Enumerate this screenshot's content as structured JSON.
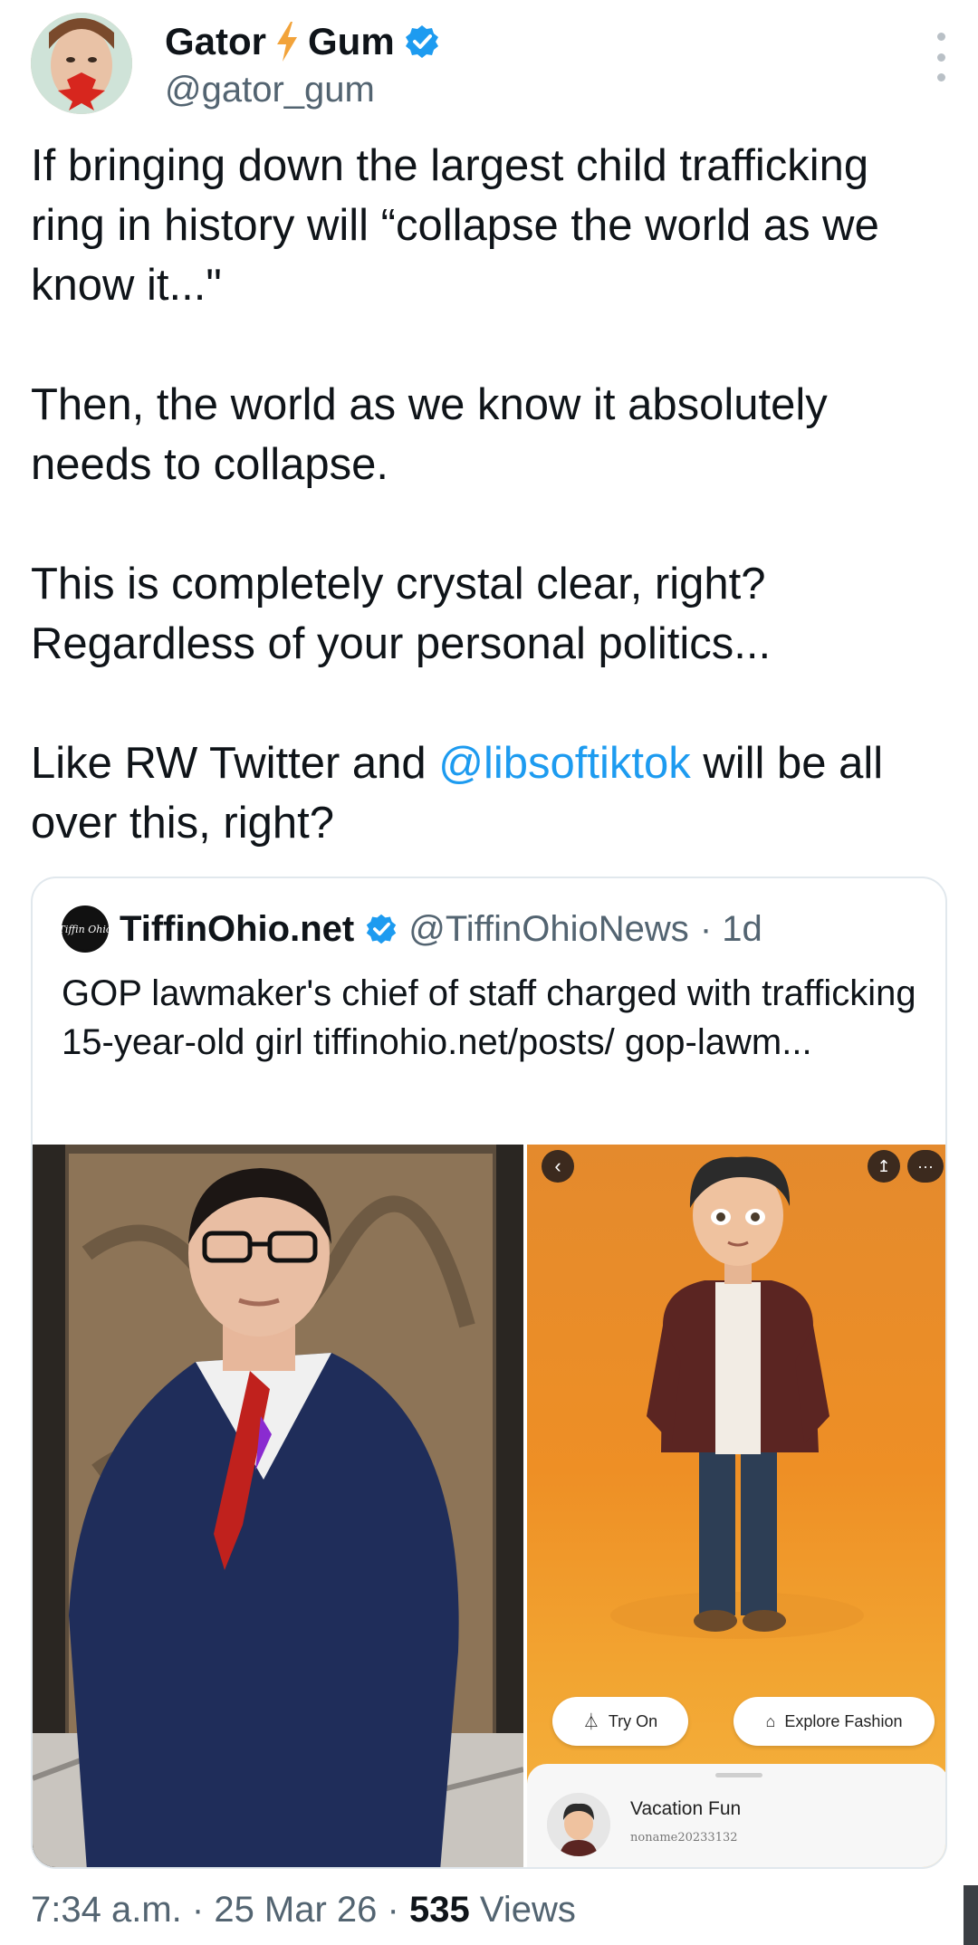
{
  "author": {
    "display_name_part1": "Gator",
    "display_name_part2": "Gum",
    "handle": "@gator_gum"
  },
  "tweet": {
    "paragraph1": "If bringing down the largest child trafficking ring in history will “collapse the world as we know it...\"",
    "paragraph2": " Then, the world as we know it absolutely needs to collapse.",
    "paragraph3": "This is completely crystal clear, right? Regardless of your personal politics...",
    "paragraph4_before": "Like RW Twitter and ",
    "paragraph4_mention": "@libsoftiktok",
    "paragraph4_after": " will be all over this, right?"
  },
  "quoted": {
    "logo_text": "Tiffin Ohio",
    "name": "TiffinOhio.net",
    "handle": "@TiffinOhioNews",
    "age": "· 1d",
    "text": "GOP lawmaker's chief of staff charged with trafficking 15-year-old girl tiffinohio.net/posts/ gop-lawm...",
    "app_screen": {
      "try_on": "Try On",
      "explore_fashion": "Explore Fashion",
      "sheet_title": "Vacation Fun",
      "sheet_user": "noname20233132"
    }
  },
  "footer": {
    "time": "7:34 a.m.",
    "date": "· 25 Mar 26 ·",
    "views_count": "535",
    "views_label": "Views"
  },
  "colors": {
    "link": "#1d9bf0",
    "verified": "#1d9bf0",
    "secondary_text": "#536471",
    "bolt": "#f2a33a"
  }
}
